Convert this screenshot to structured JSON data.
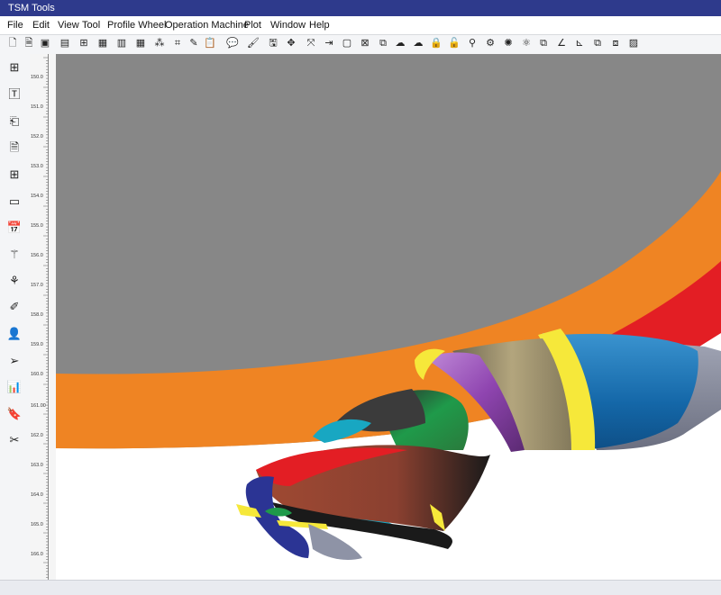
{
  "app": {
    "title": "TSM Tools"
  },
  "menu": [
    "File",
    "Edit",
    "View",
    "Tool",
    "Profile Wheel",
    "Operation Machine",
    "Plot",
    "Window",
    "Help"
  ],
  "toolbar_icons": [
    "new-file-icon",
    "open-file-icon",
    "save-icon",
    "layout-icon",
    "grid-icon",
    "panel-icon",
    "columns-icon",
    "table-icon",
    "node-graph-icon",
    "crop-icon",
    "pencil-icon",
    "clipboard-icon",
    "comment-icon",
    "brush-icon",
    "save-disk-icon",
    "move-icon",
    "expand-icon",
    "import-icon",
    "frame-icon",
    "no-crop-icon",
    "copy-icon",
    "cloud-upload-icon",
    "cloud-download-icon",
    "lock-icon",
    "unlock-icon",
    "link-icon",
    "gear-icon",
    "settings-icon",
    "layers-icon",
    "angle-icon",
    "chart-axis-icon",
    "duplicate-icon",
    "overlay-icon",
    "hatch-icon"
  ],
  "left_tools": [
    "dashboard-icon",
    "text-tool-icon",
    "clip-icon",
    "document-icon",
    "add-panel-icon",
    "window-icon",
    "calendar-icon",
    "sprinkle-icon",
    "cut-tool-icon",
    "paint-icon",
    "person-icon",
    "send-icon",
    "bar-chart-icon",
    "bookmark-icon",
    "scissors-icon"
  ],
  "ruler": {
    "labels": [
      "150.0",
      "151.0",
      "152.0",
      "153.0",
      "154.0",
      "155.0",
      "156.0",
      "157.0",
      "158.0",
      "159.0",
      "160.0",
      "161.00",
      "162.0",
      "163.0",
      "164.0",
      "165.0",
      "166.0"
    ]
  },
  "colors": {
    "titlebar": "#2e3a8c",
    "background_gray": "#878787",
    "wheel_orange": "#ef8423",
    "wheel_red": "#e31e24",
    "tool_blue": "#1577b5",
    "tool_yellow": "#f6e83a",
    "tool_purple": "#9b59b6",
    "tool_green": "#1f9a4a",
    "tool_teal": "#18a7c2",
    "tool_brown": "#a04a33",
    "tool_navy": "#2b3494"
  }
}
